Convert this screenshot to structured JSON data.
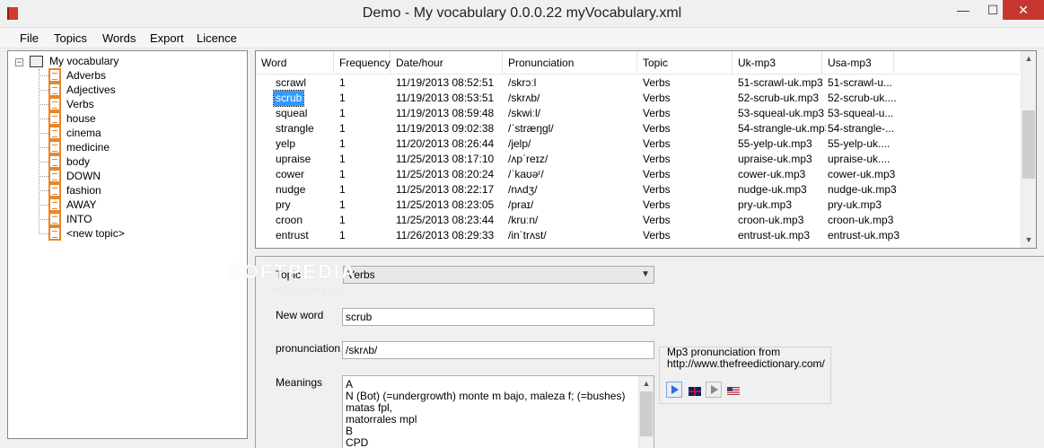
{
  "window": {
    "title": "Demo - My vocabulary 0.0.0.22  myVocabulary.xml",
    "min_glyph": "—",
    "max_glyph": "☐",
    "close_glyph": "✕"
  },
  "menu": [
    "File",
    "Topics",
    "Words",
    "Export",
    "Licence"
  ],
  "tree": {
    "root_label": "My vocabulary",
    "items": [
      "Adverbs",
      "Adjectives",
      "Verbs",
      "house",
      "cinema",
      "medicine",
      "body",
      "DOWN",
      "fashion",
      "AWAY",
      "INTO",
      "<new topic>"
    ]
  },
  "grid": {
    "columns": [
      "Word",
      "Frequency",
      "Date/hour",
      "Pronunciation",
      "Topic",
      "Uk-mp3",
      "Usa-mp3"
    ],
    "rows": [
      [
        "scrawl",
        "1",
        "11/19/2013 08:52:51",
        "/skrɔːl",
        "Verbs",
        "51-scrawl-uk.mp3",
        "51-scrawl-u..."
      ],
      [
        "scrub",
        "1",
        "11/19/2013 08:53:51",
        "/skrʌb/",
        "Verbs",
        "52-scrub-uk.mp3",
        "52-scrub-uk...."
      ],
      [
        "squeal",
        "1",
        "11/19/2013 08:59:48",
        "/skwiːl/",
        "Verbs",
        "53-squeal-uk.mp3",
        "53-squeal-u..."
      ],
      [
        "strangle",
        "1",
        "11/19/2013 09:02:38",
        "/ˈstræŋgl/",
        "Verbs",
        "54-strangle-uk.mp3",
        "54-strangle-..."
      ],
      [
        "yelp",
        "1",
        "11/20/2013 08:26:44",
        "/jelp/",
        "Verbs",
        "55-yelp-uk.mp3",
        "55-yelp-uk...."
      ],
      [
        "upraise",
        "1",
        "11/25/2013 08:17:10",
        "/ʌpˈreɪz/",
        "Verbs",
        "upraise-uk.mp3",
        "upraise-uk...."
      ],
      [
        "cower",
        "1",
        "11/25/2013 08:20:24",
        "/ˈkaʊəʳ/",
        "Verbs",
        "cower-uk.mp3",
        "cower-uk.mp3"
      ],
      [
        "nudge",
        "1",
        "11/25/2013 08:22:17",
        "/nʌdʒ/",
        "Verbs",
        "nudge-uk.mp3",
        "nudge-uk.mp3"
      ],
      [
        "pry",
        "1",
        "11/25/2013 08:23:05",
        "/praɪ/",
        "Verbs",
        "pry-uk.mp3",
        "pry-uk.mp3"
      ],
      [
        "croon",
        "1",
        "11/25/2013 08:23:44",
        "/kruːn/",
        "Verbs",
        "croon-uk.mp3",
        "croon-uk.mp3"
      ],
      [
        "entrust",
        "1",
        "11/26/2013 08:29:33",
        "/inˈtrʌst/",
        "Verbs",
        "entrust-uk.mp3",
        "entrust-uk.mp3"
      ]
    ],
    "selected_word": "scrub",
    "scroll_up": "▲",
    "scroll_down": "▼"
  },
  "editor": {
    "topic_label": "Topic",
    "topic_value": "Verbs",
    "new_word_label": "New word",
    "new_word_value": "scrub",
    "pronunciation_label": "pronunciation",
    "pronunciation_value": "/skrʌb/",
    "meanings_label": "Meanings",
    "meanings_lines": [
      "A",
      "N (Bot) (=undergrowth) monte m bajo, maleza f; (=bushes) matas fpl,",
      "matorrales mpl",
      "B",
      "CPD"
    ],
    "mp3_title": "Mp3 pronunciation from",
    "mp3_url": "http://www.thefreedictionary.com/",
    "dropdown_glyph": "▼"
  },
  "watermark": {
    "text": "SOFTPEDIA",
    "url": "www.softpedia.com"
  }
}
